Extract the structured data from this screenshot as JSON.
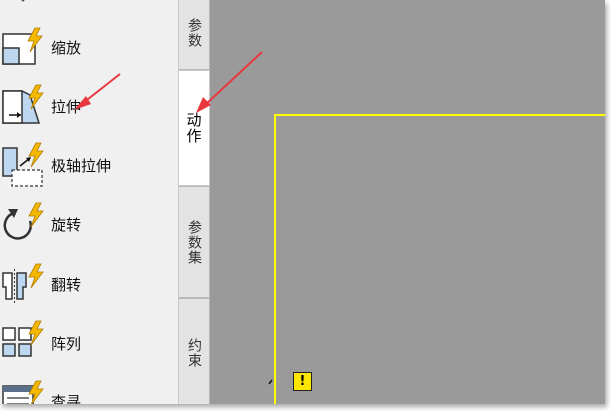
{
  "palette": {
    "items": [
      {
        "label": "缩放",
        "icon": "scale-action-icon"
      },
      {
        "label": "拉伸",
        "icon": "stretch-action-icon"
      },
      {
        "label": "极轴拉伸",
        "icon": "polar-stretch-action-icon"
      },
      {
        "label": "旋转",
        "icon": "rotate-action-icon"
      },
      {
        "label": "翻转",
        "icon": "flip-action-icon"
      },
      {
        "label": "阵列",
        "icon": "array-action-icon"
      },
      {
        "label": "查寻",
        "icon": "lookup-action-icon"
      }
    ]
  },
  "tabs": {
    "params": "参数",
    "actions": "动作",
    "param_sets": "参数集",
    "constraints": "约束"
  },
  "canvas": {
    "warning_badge": "!"
  },
  "colors": {
    "canvas_bg": "#9a9a9a",
    "boundary": "#ffff00",
    "annotation_arrow": "#e8383d",
    "lightning": "#f5b800"
  }
}
